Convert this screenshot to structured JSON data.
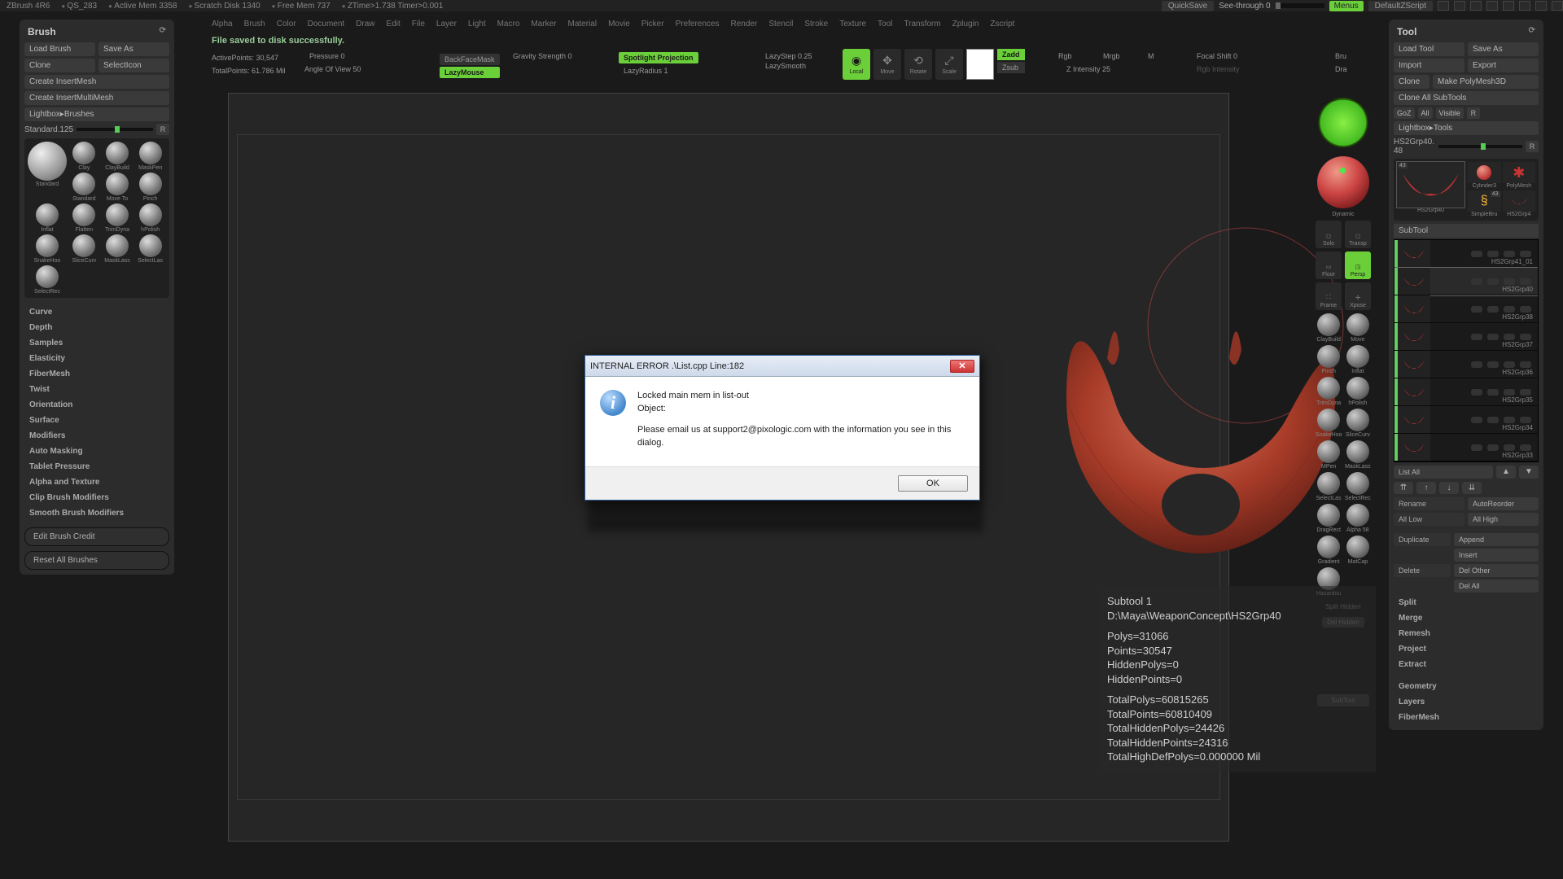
{
  "topstrip": {
    "app": "ZBrush 4R6",
    "doc": "QS_283",
    "mem": "Active Mem 3358",
    "scratch": "Scratch Disk 1340",
    "free": "Free Mem 737",
    "ztime": "ZTime>1.738 Timer>0.001",
    "quicksave": "QuickSave",
    "seethrough": "See-through   0",
    "menus": "Menus",
    "defscript": "DefaultZScript"
  },
  "menubar": [
    "Alpha",
    "Brush",
    "Color",
    "Document",
    "Draw",
    "Edit",
    "File",
    "Layer",
    "Light",
    "Macro",
    "Marker",
    "Material",
    "Movie",
    "Picker",
    "Preferences",
    "Render",
    "Stencil",
    "Stroke",
    "Texture",
    "Tool",
    "Transform",
    "Zplugin",
    "Zscript"
  ],
  "brushpanel": {
    "title": "Brush",
    "load": "Load Brush",
    "saveas": "Save As",
    "clone": "Clone",
    "selecticon": "SelectIcon",
    "insertmesh": "Create InsertMesh",
    "insertmulti": "Create InsertMultiMesh",
    "lightbox": "Lightbox▸Brushes",
    "sizelabel": "Standard.125",
    "brushes": [
      {
        "name": "Standard",
        "sel": true
      },
      {
        "name": "Clay"
      },
      {
        "name": "ClayBuild"
      },
      {
        "name": "MaskPen"
      },
      {
        "name": "Standard"
      },
      {
        "name": "Move To"
      },
      {
        "name": "Pinch"
      },
      {
        "name": "Inflat"
      },
      {
        "name": "Flatten"
      },
      {
        "name": "TrimDyna"
      },
      {
        "name": "hPolish"
      },
      {
        "name": "SnakeHoo"
      },
      {
        "name": "SliceCurv"
      },
      {
        "name": "MaskLass"
      },
      {
        "name": "SelectLas"
      },
      {
        "name": "SelectRec"
      }
    ],
    "sections": [
      "Curve",
      "Depth",
      "Samples",
      "Elasticity",
      "FiberMesh",
      "Twist",
      "Orientation",
      "Surface",
      "Modifiers",
      "Auto Masking",
      "Tablet Pressure",
      "Alpha and Texture",
      "Clip Brush Modifiers",
      "Smooth Brush Modifiers"
    ],
    "editcredit": "Edit Brush Credit",
    "resetall": "Reset All Brushes"
  },
  "toolpanel": {
    "title": "Tool",
    "load": "Load Tool",
    "saveas": "Save As",
    "import": "Import",
    "export": "Export",
    "clone": "Clone",
    "makepoly": "Make PolyMesh3D",
    "cloneall": "Clone All SubTools",
    "goz": "GoZ",
    "all": "All",
    "visible": "Visible",
    "lightbox": "Lightbox▸Tools",
    "toolname": "HS2Grp40. 48",
    "badge": "43",
    "tools": [
      {
        "name": "HS2Grp40",
        "sel": true
      },
      {
        "name": "Cylinder3"
      },
      {
        "name": "PolyMesh"
      },
      {
        "name": "SimpleBru"
      },
      {
        "name": "HS2Grp4"
      }
    ],
    "subtool_header": "SubTool",
    "subtools": [
      {
        "name": "HS2Grp41_01"
      },
      {
        "name": "HS2Grp40",
        "sel": true
      },
      {
        "name": "HS2Grp38"
      },
      {
        "name": "HS2Grp37"
      },
      {
        "name": "HS2Grp36"
      },
      {
        "name": "HS2Grp35"
      },
      {
        "name": "HS2Grp34"
      },
      {
        "name": "HS2Grp33"
      }
    ],
    "listall": "List All",
    "rename": "Rename",
    "autoreorder": "AutoReorder",
    "alllow": "All Low",
    "allhigh": "All High",
    "duplicate": "Duplicate",
    "append": "Append",
    "insert": "Insert",
    "delete": "Delete",
    "delother": "Del Other",
    "delall": "Del All",
    "extras": [
      "Split",
      "Merge",
      "Remesh",
      "Project",
      "Extract",
      "",
      "Geometry",
      "Layers",
      "FiberMesh"
    ]
  },
  "toptool": {
    "saved": "File saved to disk successfully.",
    "activepoints": "ActivePoints: 30,547",
    "totalpoints": "TotalPoints: 61.786 Mil",
    "pressure": "Pressure 0",
    "aov": "Angle Of View 50",
    "backface": "BackFaceMask",
    "lazymouse": "LazyMouse",
    "gravity": "Gravity Strength 0",
    "spotlight": "Spotlight Projection",
    "lazyradius": "LazyRadius 1",
    "lazystep": "LazyStep 0.25",
    "lazysmooth": "LazySmooth",
    "local": "Local",
    "move": "Move",
    "rotate": "Rotate",
    "scale": "Scale",
    "zadd": "Zadd",
    "zsub": "Zsub",
    "rgb": "Rgb",
    "mrgb": "Mrgb",
    "m": "M",
    "zintensity": "Z Intensity 25",
    "rgbintensity": "Rgb Intensity",
    "focal": "Focal Shift 0",
    "bru": "Bru",
    "dra": "Dra"
  },
  "rvt": {
    "dynamic": "Dynamic",
    "solo": "Solo",
    "transp": "Transp",
    "floor": "Floor",
    "persp": "Persp",
    "frame": "Frame",
    "xpose": "Xpose",
    "brushes": [
      "ClayBuild",
      "Move",
      "Pinch",
      "Inflat",
      "TrimDyna",
      "hPolish",
      "SnakeHoo",
      "SliceCurv",
      "MPen",
      "MaskLass",
      "SelectLas",
      "SelectRec",
      "DragRect",
      "Alpha 58",
      "Gradient",
      "MatCap",
      "Hazardou"
    ],
    "splithidden": "Split Hidden",
    "delhidden": "Del Hidden",
    "subtool": "SubTool"
  },
  "info": {
    "l1": "Subtool 1",
    "l2": "D:\\Maya\\WeaponConcept\\HS2Grp40",
    "l3": "Polys=31066",
    "l4": "Points=30547",
    "l5": "HiddenPolys=0",
    "l6": "HiddenPoints=0",
    "l7": "TotalPolys=60815265",
    "l8": "TotalPoints=60810409",
    "l9": "TotalHiddenPolys=24426",
    "l10": "TotalHiddenPoints=24316",
    "l11": "TotalHighDefPolys=0.000000 Mil"
  },
  "dialog": {
    "title": "INTERNAL ERROR .\\List.cpp   Line:182",
    "msg1": "Locked main mem in list-out",
    "msg2": "Object:",
    "msg3": "Please email us at support2@pixologic.com with the information you see in this dialog.",
    "ok": "OK"
  }
}
